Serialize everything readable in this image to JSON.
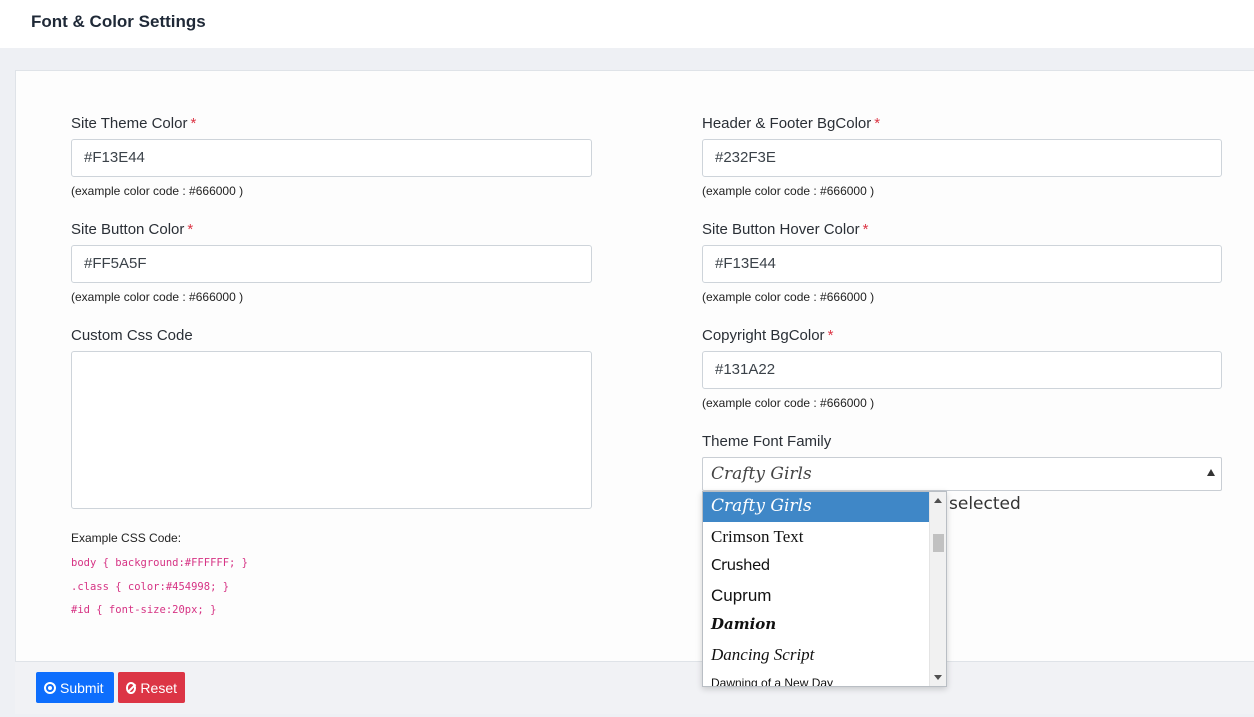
{
  "header": {
    "title": "Font & Color Settings"
  },
  "required_mark": "*",
  "fields": {
    "site_theme_color": {
      "label": "Site Theme Color",
      "value": "#F13E44",
      "hint": "(example color code : #666000 )"
    },
    "header_footer_bgcolor": {
      "label": "Header & Footer BgColor",
      "value": "#232F3E",
      "hint": "(example color code : #666000 )"
    },
    "site_button_color": {
      "label": "Site Button Color",
      "value": "#FF5A5F",
      "hint": "(example color code : #666000 )"
    },
    "site_button_hover_color": {
      "label": "Site Button Hover Color",
      "value": "#F13E44",
      "hint": "(example color code : #666000 )"
    },
    "custom_css_code": {
      "label": "Custom Css Code",
      "value": ""
    },
    "copyright_bgcolor": {
      "label": "Copyright BgColor",
      "value": "#131A22",
      "hint": "(example color code : #666000 )"
    },
    "theme_font_family": {
      "label": "Theme Font Family",
      "value": "Crafty Girls",
      "selected_suffix": "selected"
    }
  },
  "example_css": {
    "title": "Example CSS Code:",
    "lines": [
      "body { background:#FFFFFF; }",
      ".class { color:#454998; }",
      "#id { font-size:20px; }"
    ]
  },
  "font_dropdown": {
    "options": [
      "Crafty Girls",
      "Crimson Text",
      "Crushed",
      "Cuprum",
      "Damion",
      "Dancing Script",
      "Dawning of a New Day"
    ]
  },
  "buttons": {
    "submit": "Submit",
    "reset": "Reset"
  },
  "colors": {
    "submit": "#0d6efd",
    "reset": "#dc3545",
    "dropdown_highlight": "#3f87c7"
  }
}
